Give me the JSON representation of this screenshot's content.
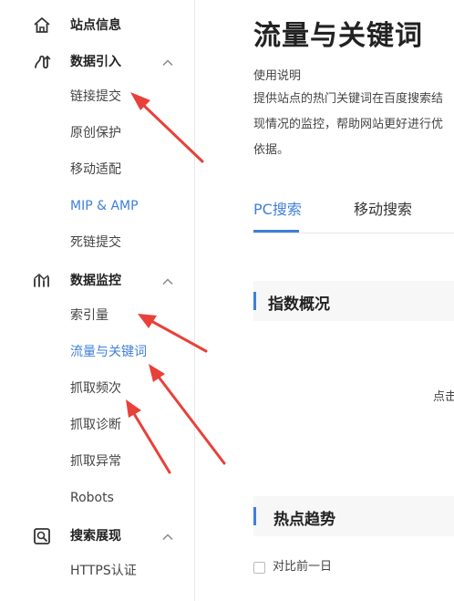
{
  "sidebar": {
    "site_info": {
      "label": "站点信息",
      "icon": "home-icon"
    },
    "data_import": {
      "label": "数据引入",
      "icon": "import-icon",
      "items": [
        "链接提交",
        "原创保护",
        "移动适配",
        "MIP & AMP",
        "死链提交"
      ]
    },
    "data_monitor": {
      "label": "数据监控",
      "icon": "monitor-chart-icon",
      "items": [
        "索引量",
        "流量与关键词",
        "抓取频次",
        "抓取诊断",
        "抓取异常",
        "Robots"
      ]
    },
    "search_display": {
      "label": "搜索展现",
      "icon": "search-display-icon",
      "items": [
        "HTTPS认证"
      ]
    },
    "active_item": "流量与关键词"
  },
  "main": {
    "title": "流量与关键词",
    "usage_title": "使用说明",
    "usage_lines": [
      "提供站点的热门关键词在百度搜索结",
      "现情况的监控，帮助网站更好进行优",
      "依据。"
    ],
    "tabs": [
      {
        "label": "PC搜索",
        "active": true
      },
      {
        "label": "移动搜索",
        "active": false
      }
    ],
    "section_index": "指数概况",
    "hint": "点击",
    "section_trend": "热点趋势",
    "compare_label": "对比前一日",
    "compare_checked": false
  },
  "colors": {
    "accent": "#3f7fd8",
    "arrow": "#e8413a"
  }
}
